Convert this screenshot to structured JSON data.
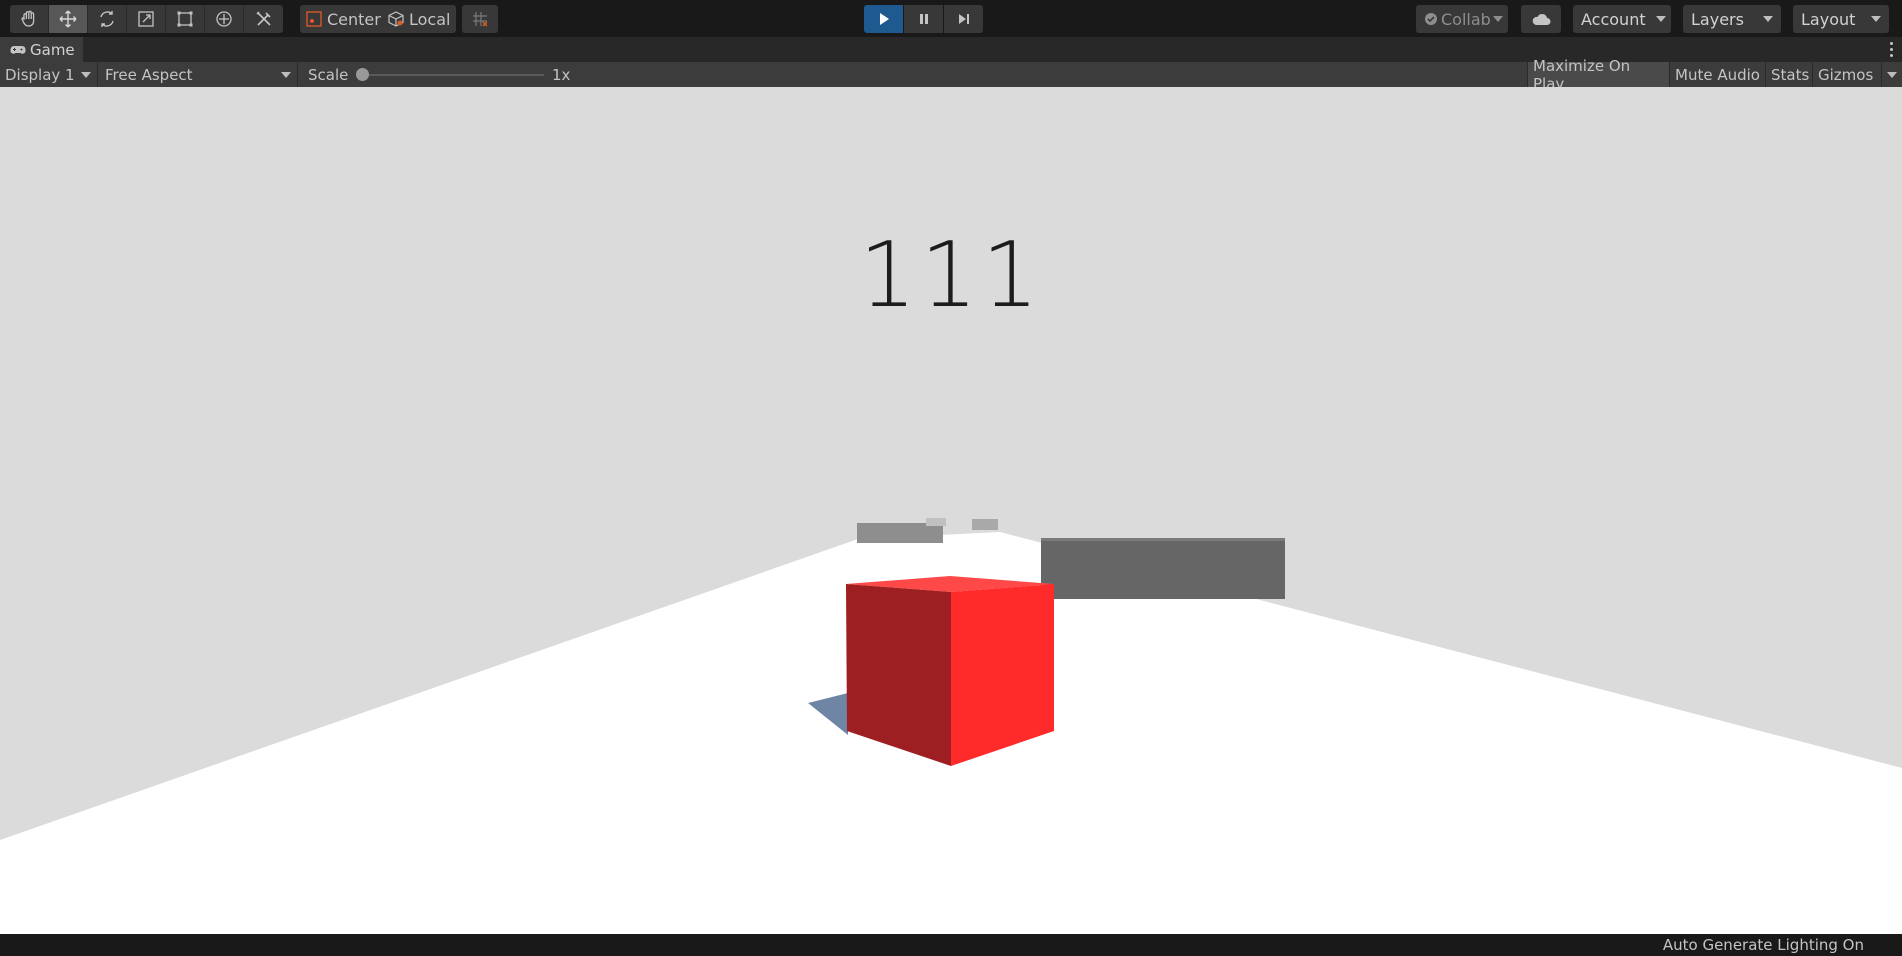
{
  "toolbar": {
    "tools": [
      "hand-tool",
      "move-tool",
      "rotate-tool",
      "scale-tool",
      "rect-tool",
      "transform-tool",
      "custom-tool"
    ],
    "active_tool": "move-tool",
    "pivot_label": "Center",
    "space_label": "Local",
    "collab_label": "Collab",
    "account_label": "Account",
    "layers_label": "Layers",
    "layout_label": "Layout"
  },
  "game_window": {
    "tab_label": "Game",
    "display_label": "Display 1",
    "aspect_label": "Free Aspect",
    "scale_label": "Scale",
    "scale_value_label": "1x",
    "scale_value": 1,
    "maximize_label": "Maximize On Play",
    "mute_label": "Mute Audio",
    "stats_label": "Stats",
    "gizmos_label": "Gizmos"
  },
  "scene": {
    "score": "111",
    "player_color": "#ff2a2a",
    "obstacle_color": "#666666",
    "ground_color": "#ffffff",
    "sky_color": "#dbdbdb"
  },
  "status": {
    "text": "Auto Generate Lighting On"
  },
  "colors": {
    "play_active": "#1e5a8f",
    "toolbar_bg": "#191919",
    "panel_bg": "#3c3c3c"
  }
}
